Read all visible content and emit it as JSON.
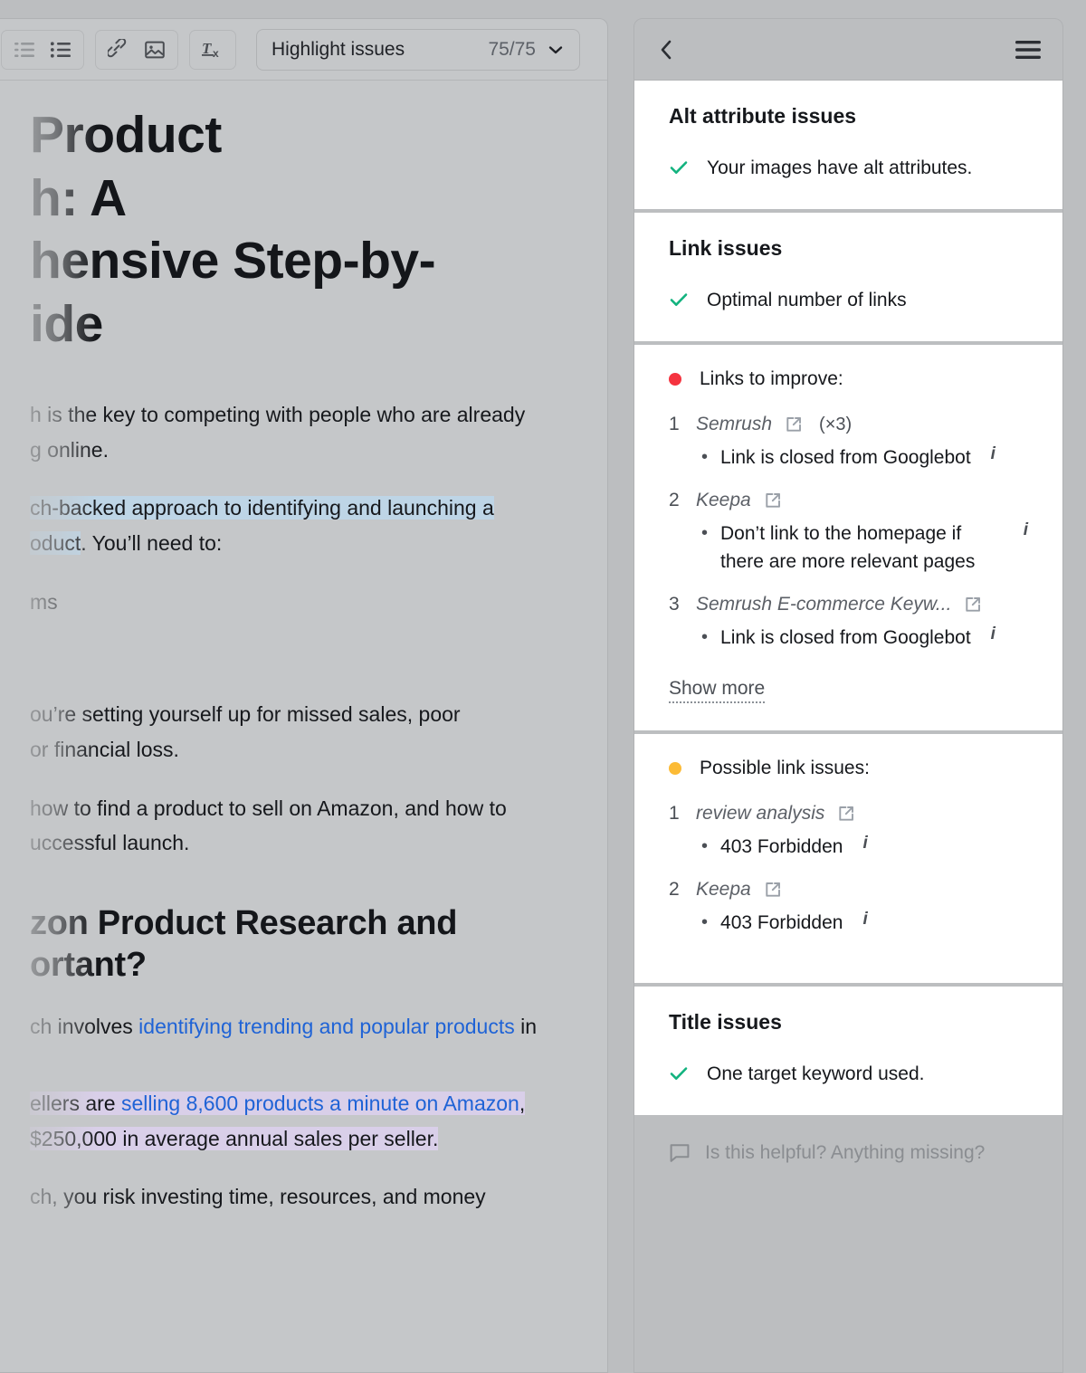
{
  "editor": {
    "toolbar": {
      "ordered_list_icon": "ordered-list-icon",
      "bullet_list_icon": "bullet-list-icon",
      "link_icon": "link-icon",
      "image_icon": "image-icon",
      "clear_format_icon": "clear-formatting-icon",
      "highlight_label": "Highlight issues",
      "highlight_count": "75/75",
      "chevron_icon": "chevron-down-icon"
    },
    "document": {
      "title_line1": "Product",
      "title_line2": "h: A",
      "title_line3": "hensive Step-by-",
      "title_line4": "ide",
      "p1_line1": "h is the key to competing with people who are already",
      "p1_line2": "g online.",
      "p2_line1": "ch-backed approach to identifying and launching a",
      "p2_line2_hl": "oduct",
      "p2_line2_rest": ". You’ll need to:",
      "p3": "ms",
      "p4_line1": "ou’re setting yourself up for missed sales, poor",
      "p4_line2": "or financial loss.",
      "p5_line1": "how to find a product to sell on Amazon, and how to",
      "p5_line2": "uccessful launch.",
      "h2_line1": "zon Product Research and",
      "h2_line2": "ortant?",
      "p6_pre": "ch invol",
      "p6_bold": "ves ",
      "p6_link": "identifying trending and popular products",
      "p6_post": " in",
      "p7_pre": "ellers ",
      "p7_mid": "are ",
      "p7_link": "selling 8,600 products a minute on Amazon",
      "p7_comma": ",",
      "p7_line2_a": "$250,000",
      "p7_line2_b": " in average annual sales per seller.",
      "p8": "ch, you risk investing time, resources, and money"
    },
    "colors": {
      "highlight_blue": "#bed5e6",
      "highlight_purple": "#d9cfe9",
      "link_blue": "#1f63d6"
    }
  },
  "panel": {
    "header": {
      "back_icon": "chevron-left-icon",
      "menu_icon": "hamburger-menu-icon"
    },
    "sections": [
      {
        "title": "Alt attribute issues",
        "ok_items": [
          "Your images have alt attributes."
        ]
      },
      {
        "title": "Link issues",
        "ok_items": [
          "Optimal number of links"
        ]
      }
    ],
    "links_to_improve": {
      "label": "Links to improve:",
      "dot_color": "#f5333f",
      "items": [
        {
          "num": "1",
          "name": "Semrush",
          "multiplier": "(×3)",
          "issue": "Link is closed from Googlebot"
        },
        {
          "num": "2",
          "name": "Keepa",
          "multiplier": "",
          "issue": "Don’t link to the homepage if there are more relevant pages"
        },
        {
          "num": "3",
          "name": "Semrush E-commerce Keyw...",
          "multiplier": "",
          "issue": "Link is closed from Googlebot"
        }
      ],
      "show_more": "Show more"
    },
    "possible_link_issues": {
      "label": "Possible link issues:",
      "dot_color": "#fcbb36",
      "items": [
        {
          "num": "1",
          "name": "review analysis",
          "issue": "403 Forbidden"
        },
        {
          "num": "2",
          "name": "Keepa",
          "issue": "403 Forbidden"
        }
      ]
    },
    "title_issues": {
      "title": "Title issues",
      "ok_items": [
        "One target keyword used."
      ]
    },
    "footer": {
      "feedback_icon": "speech-bubble-icon",
      "feedback_text": "Is this helpful? Anything missing?"
    },
    "colors": {
      "check_green": "#13b37f",
      "error_red": "#f5333f",
      "warning_yellow": "#fcbb36"
    }
  }
}
